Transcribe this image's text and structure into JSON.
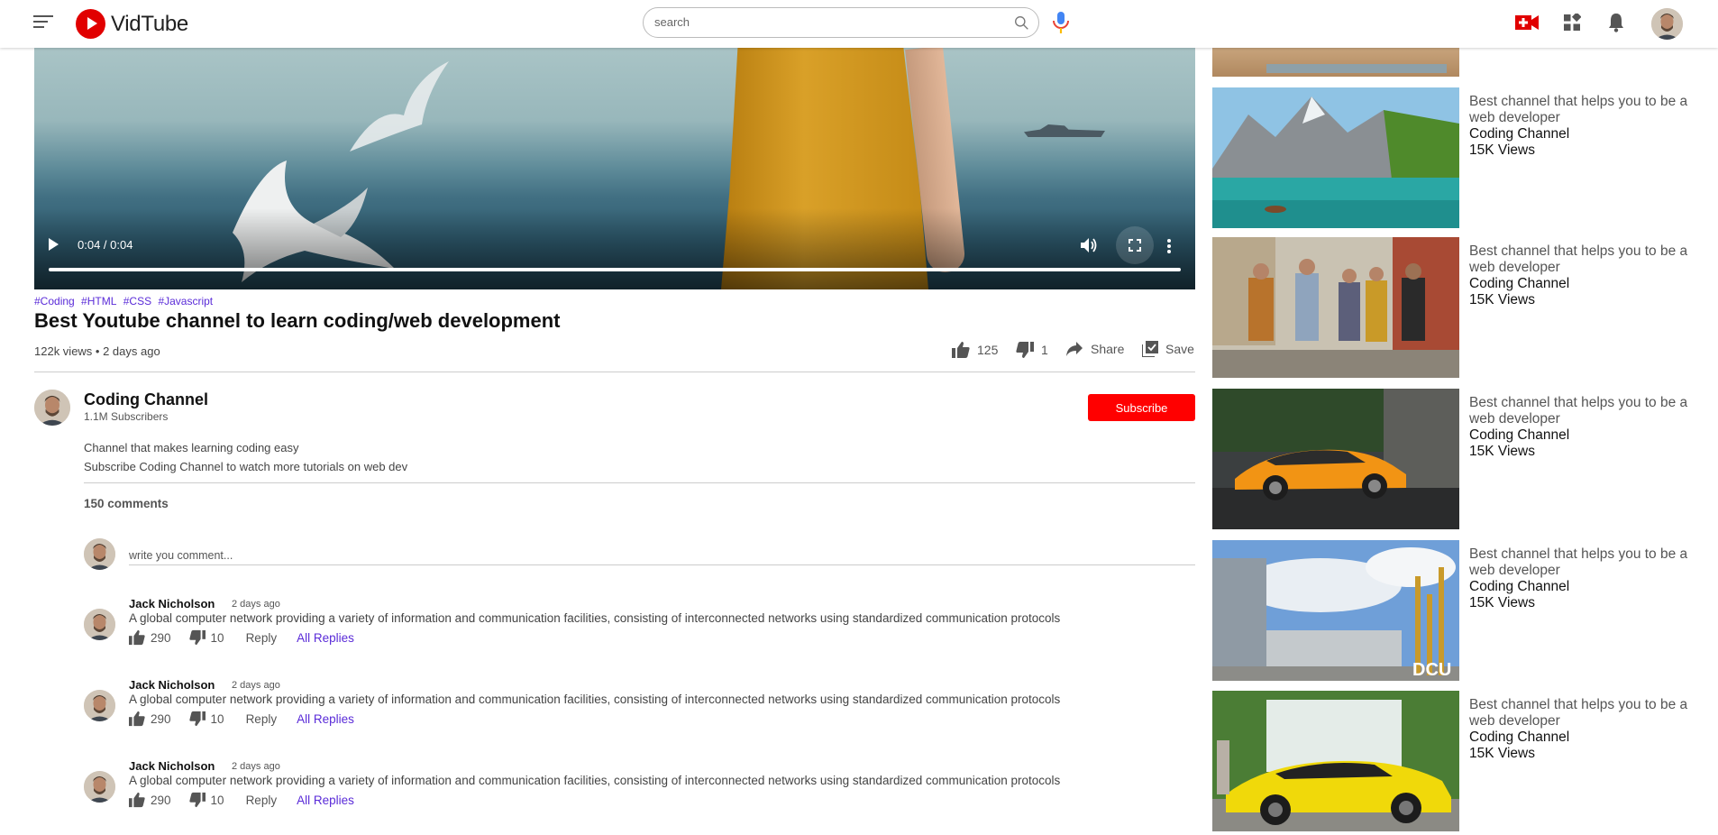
{
  "header": {
    "logo_text": "VidTube",
    "search_placeholder": "search"
  },
  "video": {
    "time": "0:04 / 0:04",
    "progress": 1.0,
    "tags": [
      "#Coding",
      "#HTML",
      "#CSS",
      "#Javascript"
    ],
    "title": "Best Youtube channel to learn coding/web development",
    "views": "122k views • 2 days ago",
    "likes": "125",
    "dislikes": "1",
    "share_label": "Share",
    "save_label": "Save"
  },
  "channel": {
    "name": "Coding Channel",
    "subscribers": "1.1M Subscribers",
    "subscribe_label": "Subscribe",
    "description_1": "Channel that makes learning coding easy",
    "description_2": "Subscribe Coding Channel to watch more tutorials on web dev"
  },
  "comments": {
    "count_label": "150 comments",
    "input_placeholder": "write you comment...",
    "items": [
      {
        "author": "Jack Nicholson",
        "time": "2 days ago",
        "text": "A global computer network providing a variety of information and communication facilities, consisting of interconnected networks using standardized communication protocols",
        "likes": "290",
        "dislikes": "10",
        "reply_label": "Reply",
        "replies_label": "All Replies"
      },
      {
        "author": "Jack Nicholson",
        "time": "2 days ago",
        "text": "A global computer network providing a variety of information and communication facilities, consisting of interconnected networks using standardized communication protocols",
        "likes": "290",
        "dislikes": "10",
        "reply_label": "Reply",
        "replies_label": "All Replies"
      },
      {
        "author": "Jack Nicholson",
        "time": "2 days ago",
        "text": "A global computer network providing a variety of information and communication facilities, consisting of interconnected networks using standardized communication protocols",
        "likes": "290",
        "dislikes": "10",
        "reply_label": "Reply",
        "replies_label": "All Replies"
      }
    ]
  },
  "recommended": [
    {
      "title": "Best channel that helps you to be a web developer",
      "channel": "Coding Channel",
      "views": "15K Views"
    },
    {
      "title": "Best channel that helps you to be a web developer",
      "channel": "Coding Channel",
      "views": "15K Views"
    },
    {
      "title": "Best channel that helps you to be a web developer",
      "channel": "Coding Channel",
      "views": "15K Views"
    },
    {
      "title": "Best channel that helps you to be a web developer",
      "channel": "Coding Channel",
      "views": "15K Views"
    },
    {
      "title": "Best channel that helps you to be a web developer",
      "channel": "Coding Channel",
      "views": "15K Views"
    }
  ],
  "colors": {
    "brand": "#ff0000",
    "link": "#5a2bd8"
  }
}
